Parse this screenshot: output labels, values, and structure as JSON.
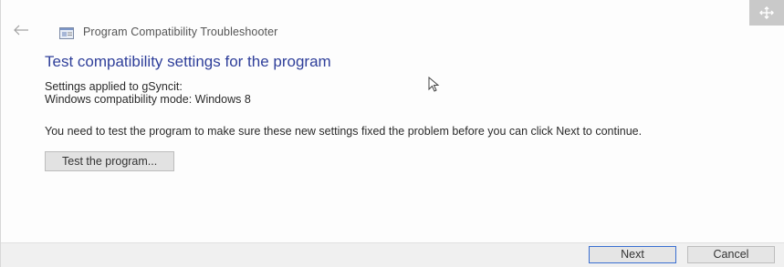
{
  "window": {
    "title": "Program Compatibility Troubleshooter",
    "back_icon": "back-arrow-icon",
    "app_icon": "troubleshooter-icon",
    "move_icon": "move-icon"
  },
  "main": {
    "heading": "Test compatibility settings for the program",
    "settings_applied": "Settings applied to gSyncit:",
    "compat_mode": "Windows compatibility mode: Windows 8",
    "instructions": "You need to test the program to make sure these new settings fixed the problem before you can click Next to continue.",
    "test_button_label": "Test the program..."
  },
  "footer": {
    "next_label": "Next",
    "cancel_label": "Cancel"
  },
  "colors": {
    "heading": "#2f3f9a",
    "focus_border": "#3a6fd1",
    "footer_bg": "#f0f0f0"
  }
}
